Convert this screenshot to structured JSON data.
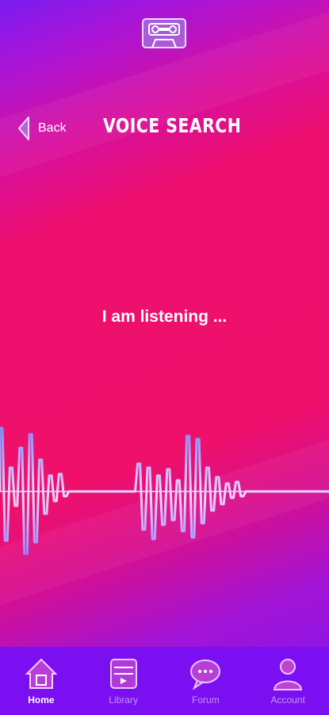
{
  "header": {
    "back_label": "Back",
    "title": "VOICE SEARCH"
  },
  "main": {
    "status_text": "I am listening ..."
  },
  "tabbar": {
    "tabs": [
      {
        "label": "Home",
        "icon": "home-icon",
        "active": true
      },
      {
        "label": "Library",
        "icon": "library-icon",
        "active": false
      },
      {
        "label": "Forum",
        "icon": "forum-icon",
        "active": false
      },
      {
        "label": "Account",
        "icon": "account-icon",
        "active": false
      }
    ]
  },
  "colors": {
    "background_top": "#7a1cf0",
    "background_mid": "#ef106c",
    "tabbar": "#7c0ff2",
    "waveform": "#b8a8ff"
  }
}
